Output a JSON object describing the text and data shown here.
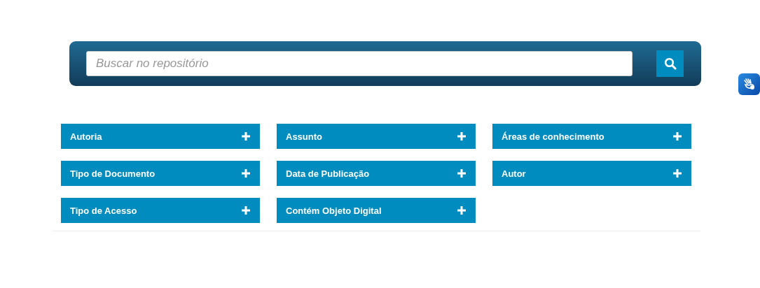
{
  "search": {
    "placeholder": "Buscar no repositório"
  },
  "facets": [
    {
      "label": "Autoria",
      "expanded": false
    },
    {
      "label": "Assunto",
      "expanded": false
    },
    {
      "label": "Áreas de conhecimento",
      "expanded": false
    },
    {
      "label": "Tipo de Documento",
      "expanded": false
    },
    {
      "label": "Data de Publicação",
      "expanded": false
    },
    {
      "label": "Autor",
      "expanded": false
    },
    {
      "label": "Tipo de Acesso",
      "expanded": false
    },
    {
      "label": "Contém Objeto Digital",
      "expanded": false
    }
  ]
}
